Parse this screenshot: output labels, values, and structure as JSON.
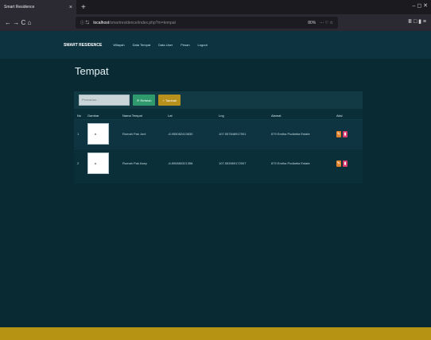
{
  "browser": {
    "tab_title": "Smart Residence",
    "tab_close": "×",
    "new_tab": "+",
    "url_host": "localhost",
    "url_path": "/smartresidence/index.php?m=tempat",
    "zoom": "80%",
    "url_actions": "··· ♡ ☆",
    "nav_icons": "← → C ⌂",
    "url_icons": "ⓘ ⇆",
    "tools": "Ⅲ □ ▮ ≡",
    "window_controls": "–  ◻  ✕"
  },
  "appnav": {
    "brand": "SMART RESIDENCE",
    "links": [
      "Wilayah",
      "Data Tempat",
      "Data User",
      "Pesan",
      "Logout"
    ]
  },
  "page": {
    "title": "Tempat"
  },
  "toolbar": {
    "search_placeholder": "Pencarian...",
    "refresh_label": "Refresh",
    "add_label": "Tambah"
  },
  "table": {
    "headers": [
      "No",
      "Gambar",
      "Nama Tempat",
      "Lat",
      "Lng",
      "Alamat",
      "Aksi"
    ],
    "rows": [
      {
        "no": "1",
        "nama": "Rumah Pak Joni",
        "lat": "-6.955082413630",
        "lng": "107.557848917001",
        "alamat": "879 Erstha Podiatria Estate"
      },
      {
        "no": "2",
        "nama": "Rumah Pak Asep",
        "lat": "-6.890880321358",
        "lng": "107.553969172007",
        "alamat": "879 Erstha Podiatria Estate"
      }
    ]
  },
  "colors": {
    "background": "#0a2a33",
    "accent_gold": "#b69312",
    "refresh_green": "#2f9b6c",
    "edit_orange": "#e0832c",
    "delete_pink": "#d93b6c"
  }
}
